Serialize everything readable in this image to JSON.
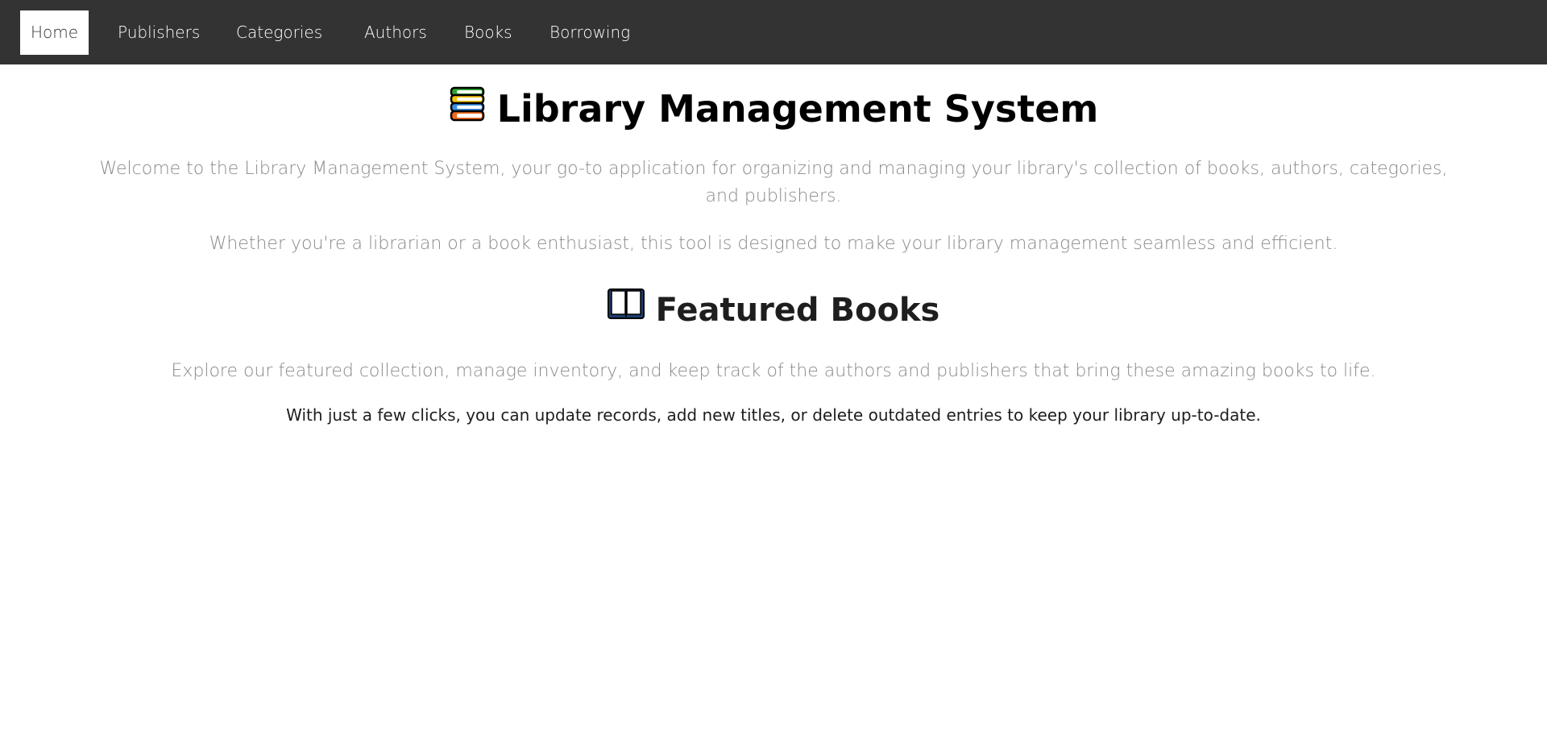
{
  "nav": {
    "items": [
      {
        "label": "Home",
        "active": true
      },
      {
        "label": "Publishers",
        "active": false
      },
      {
        "label": "Categories",
        "active": false
      },
      {
        "label": "Authors",
        "active": false
      },
      {
        "label": "Books",
        "active": false
      },
      {
        "label": "Borrowing",
        "active": false
      }
    ]
  },
  "hero": {
    "title": "Library Management System",
    "title_icon": "books-stack-icon",
    "intro": "Welcome to the Library Management System, your go-to application for organizing and managing your library's collection of books, authors, categories, and publishers.",
    "subtext": "Whether you're a librarian or a book enthusiast, this tool is designed to make your library management seamless and efficient."
  },
  "featured": {
    "title": "Featured Books",
    "title_icon": "open-book-icon",
    "description": "Explore our featured collection, manage inventory, and keep track of the authors and publishers that bring these amazing books to life.",
    "note": "With just a few clicks, you can update records, add new titles, or delete outdated entries to keep your library up-to-date."
  },
  "colors": {
    "navbar": "#333333",
    "nav_text": "#ffffff",
    "active_bg": "#ffffff",
    "muted_text": "#8a8a8a",
    "heading": "#000000"
  }
}
